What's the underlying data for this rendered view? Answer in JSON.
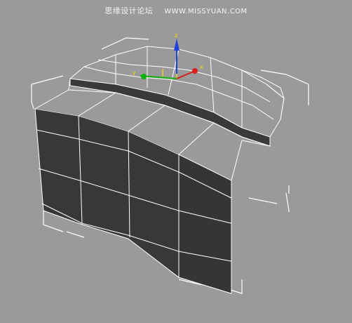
{
  "watermark": {
    "site_name": "思缘设计论坛",
    "site_url": "WWW.MISSYUAN.COM"
  },
  "viewport": {
    "background_color": "#9a9a9a",
    "mesh_face_color": "#3a3a3a",
    "wire_color": "#ffffff",
    "bounding_box_color": "#ffffff"
  },
  "gizmo": {
    "type": "move-transform-gizmo",
    "axes": [
      {
        "name": "Z",
        "color": "#1f3fd8"
      },
      {
        "name": "X",
        "color": "#d81f1f"
      },
      {
        "name": "Y",
        "color": "#10b010"
      }
    ],
    "plane_handle_color": "#f0e000"
  }
}
